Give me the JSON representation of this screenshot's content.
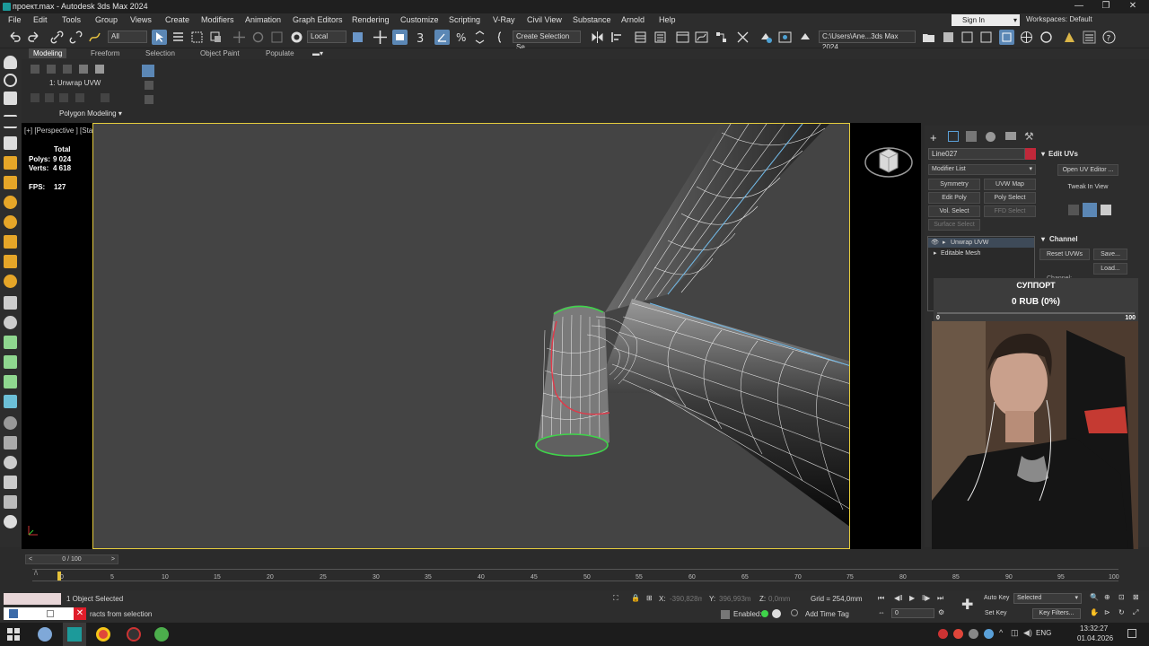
{
  "window": {
    "title": "проект.max - Autodesk 3ds Max 2024",
    "min": "—",
    "max": "❐",
    "close": "✕"
  },
  "menus": [
    "File",
    "Edit",
    "Tools",
    "Group",
    "Views",
    "Create",
    "Modifiers",
    "Animation",
    "Graph Editors",
    "Rendering",
    "Customize",
    "Scripting",
    "V-Ray",
    "Civil View",
    "Substance",
    "Arnold",
    "Help"
  ],
  "signin": "Sign In",
  "workspaces": {
    "label": "Workspaces:",
    "value": "Default"
  },
  "toolbar": {
    "filter_dropdown": "All",
    "coord_dropdown": "Local",
    "selection_set": "Create Selection Se",
    "path": "C:\\Users\\Ane...3ds Max 2024"
  },
  "ribbon": {
    "tabs": [
      "Modeling",
      "Freeform",
      "Selection",
      "Object Paint",
      "Populate"
    ],
    "modifier_label": "1: Unwrap UVW",
    "panel_label": "Polygon Modeling"
  },
  "viewport": {
    "label": "[+] [Perspective ] [Standard ] [Default Shading ]",
    "stats_total": "Total",
    "polys_label": "Polys:",
    "polys_value": "9 024",
    "verts_label": "Verts:",
    "verts_value": "4 618",
    "fps_label": "FPS:",
    "fps_value": "127"
  },
  "command_panel": {
    "object_name": "Line027",
    "object_color": "#c0283a",
    "modifier_list": "Modifier List",
    "buttons": [
      "Symmetry",
      "UVW Map",
      "Edit Poly",
      "Poly Select",
      "Vol. Select",
      "FFD Select",
      "Surface Select"
    ],
    "stack": [
      "Unwrap UVW",
      "Editable Mesh"
    ],
    "edit_uvs_title": "Edit UVs",
    "open_uv_editor": "Open UV Editor ...",
    "tweak_in_view": "Tweak In View",
    "channel_title": "Channel",
    "reset_uvws": "Reset UVWs",
    "save": "Save...",
    "load": "Load...",
    "channel_label": "Channel:"
  },
  "donation": {
    "title": "СУППОРТ",
    "amount": "0 RUB (0%)",
    "min": "0",
    "max": "100",
    "progress": 0
  },
  "timeline": {
    "frame": "0 / 100",
    "ticks": [
      "0",
      "5",
      "10",
      "15",
      "20",
      "25",
      "30",
      "35",
      "40",
      "45",
      "50",
      "55",
      "60",
      "65",
      "70",
      "75",
      "80",
      "85",
      "90",
      "95",
      "100"
    ]
  },
  "status": {
    "selected": "1 Object Selected",
    "prompt": "racts from selection",
    "x_label": "X:",
    "x_value": "-390,828m",
    "y_label": "Y:",
    "y_value": "396,993m",
    "z_label": "Z:",
    "z_value": "0,0mm",
    "grid": "Grid = 254,0mm",
    "enabled": "Enabled:",
    "add_time_tag": "Add Time Tag",
    "autokey": "Auto Key",
    "setkey": "Set Key",
    "selected_dropdown": "Selected",
    "key_filters": "Key Filters...",
    "frame_field": "0"
  },
  "taskbar": {
    "lang": "ENG",
    "time": "13:32:27",
    "date": "01.04.2026"
  }
}
